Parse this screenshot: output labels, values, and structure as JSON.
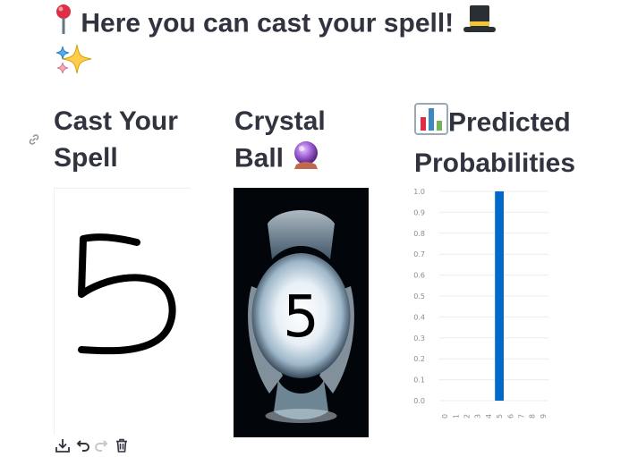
{
  "page": {
    "title": "Here you can cast your spell!",
    "title_icon_left": "pushpin-icon",
    "title_icon_right": "top-hat-icon",
    "subtitle_icon": "sparkles-icon"
  },
  "columns": {
    "cast": {
      "title_line1": "Cast Your",
      "title_line2": "Spell",
      "drawn_digit": "5",
      "toolbar": [
        "download-icon",
        "undo-icon",
        "redo-icon",
        "trash-icon"
      ]
    },
    "crystal": {
      "title_line1": "Crystal",
      "title_line2": "Ball",
      "title_icon": "crystal-ball-icon",
      "prediction": "5"
    },
    "probabilities": {
      "title_line1": "Predicted",
      "title_line2": "Probabilities",
      "title_icon": "bar-chart-icon"
    }
  },
  "chart_data": {
    "type": "bar",
    "categories": [
      "0",
      "1",
      "2",
      "3",
      "4",
      "5",
      "6",
      "7",
      "8",
      "9"
    ],
    "values": [
      0,
      0,
      0,
      0,
      0,
      1.0,
      0,
      0,
      0,
      0
    ],
    "ylim": [
      0,
      1.0
    ],
    "yticks": [
      "0.0",
      "0.1",
      "0.2",
      "0.3",
      "0.4",
      "0.5",
      "0.6",
      "0.7",
      "0.8",
      "0.9",
      "1.0"
    ],
    "grid": true,
    "bar_color": "#0068c9"
  }
}
